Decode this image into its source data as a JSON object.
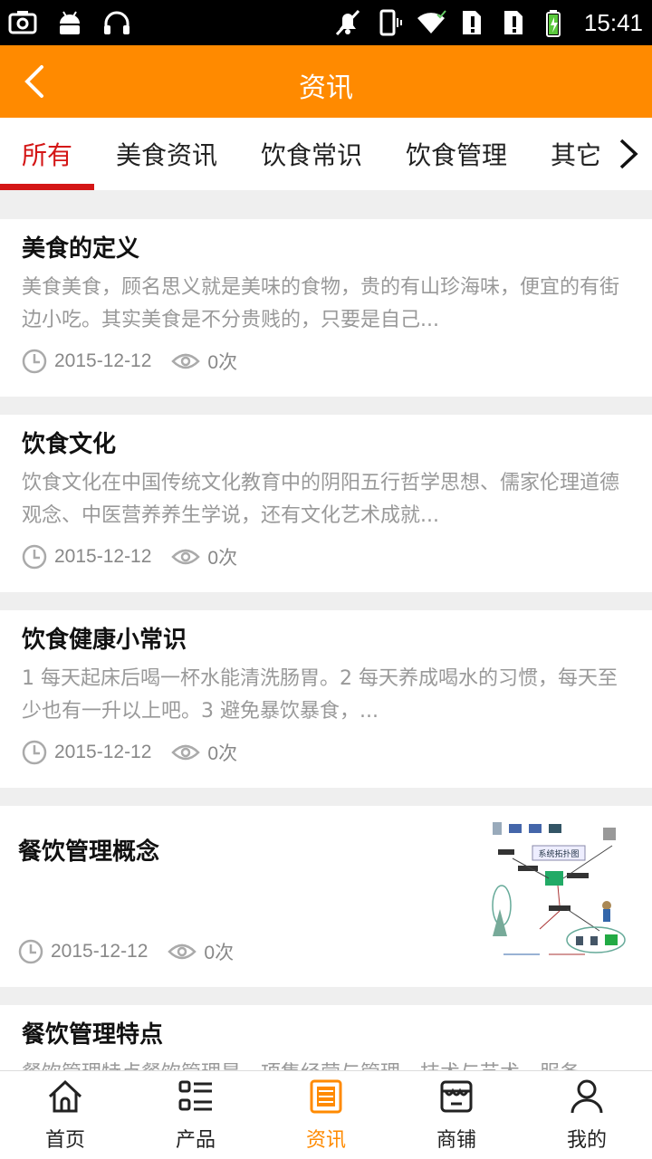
{
  "status_bar": {
    "time": "15:41"
  },
  "header": {
    "title": "资讯",
    "back_icon": "chevron-left-icon"
  },
  "tabs": {
    "items": [
      {
        "label": "所有",
        "active": true
      },
      {
        "label": "美食资讯"
      },
      {
        "label": "饮食常识"
      },
      {
        "label": "饮食管理"
      },
      {
        "label": "其它"
      }
    ],
    "more_icon": "chevron-right-icon"
  },
  "articles": [
    {
      "title": "美食的定义",
      "summary": "美食美食，顾名思义就是美味的食物，贵的有山珍海味，便宜的有街边小吃。其实美食是不分贵贱的，只要是自己...",
      "date": "2015-12-12",
      "views": "0次"
    },
    {
      "title": "饮食文化",
      "summary": "饮食文化在中国传统文化教育中的阴阳五行哲学思想、儒家伦理道德观念、中医营养养生学说，还有文化艺术成就...",
      "date": "2015-12-12",
      "views": "0次"
    },
    {
      "title": "饮食健康小常识",
      "summary": "1 每天起床后喝一杯水能清洗肠胃。2 每天养成喝水的习惯，每天至少也有一升以上吧。3 避免暴饮暴食，...",
      "date": "2015-12-12",
      "views": "0次"
    },
    {
      "title": "餐饮管理概念",
      "date": "2015-12-12",
      "views": "0次",
      "thumbnail_text": "系统拓扑图"
    },
    {
      "title": "餐饮管理特点",
      "summary": "餐饮管理特点餐饮管理是一项集经营与管理、技术与艺术、服务..."
    }
  ],
  "bottom_nav": {
    "items": [
      {
        "label": "首页",
        "icon": "home-icon"
      },
      {
        "label": "产品",
        "icon": "list-icon"
      },
      {
        "label": "资讯",
        "icon": "news-icon",
        "active": true
      },
      {
        "label": "商铺",
        "icon": "store-icon"
      },
      {
        "label": "我的",
        "icon": "user-icon"
      }
    ]
  },
  "colors": {
    "accent": "#ff8a00",
    "tab_active": "#d41616"
  }
}
